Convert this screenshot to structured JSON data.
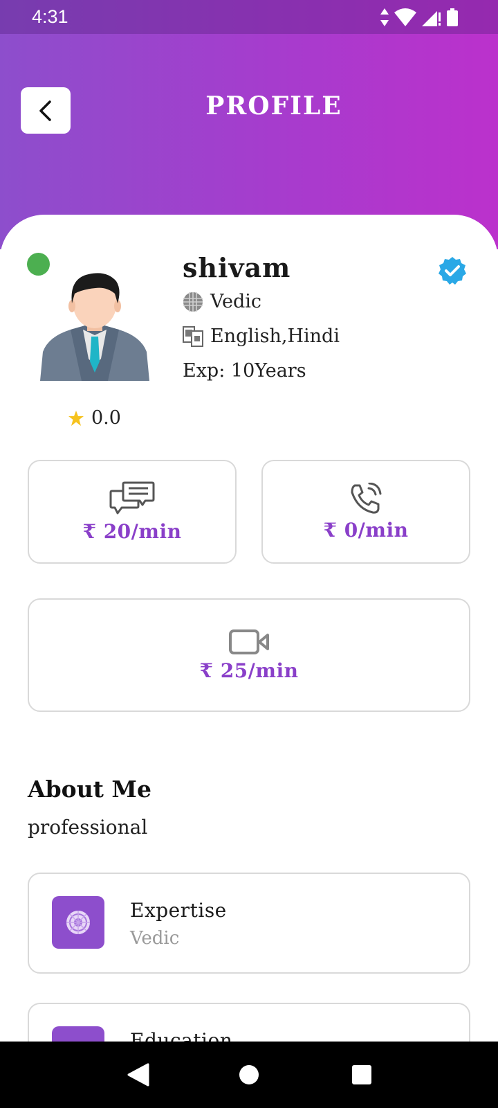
{
  "status_bar": {
    "time": "4:31",
    "icons": [
      "data-arrows-icon",
      "wifi-icon",
      "signal-icon",
      "battery-icon"
    ]
  },
  "header": {
    "title": "PROFILE",
    "back_icon": "chevron-left-icon",
    "gradient_colors": [
      "#8d4ecc",
      "#bb31cc"
    ]
  },
  "profile": {
    "name": "shivam",
    "online": true,
    "online_color": "#4caf50",
    "verified": true,
    "verified_color": "#2aa8e6",
    "skill": "Vedic",
    "languages": "English,Hindi",
    "experience": "Exp: 10Years",
    "rating": "0.0"
  },
  "pricing": {
    "chat": {
      "icon": "chat-bubbles-icon",
      "price": "₹ 20/min"
    },
    "call": {
      "icon": "phone-icon",
      "price": "₹ 0/min"
    },
    "video": {
      "icon": "video-camera-icon",
      "price": "₹ 25/min"
    },
    "accent": "#8a3fc9"
  },
  "about": {
    "title": "About Me",
    "text": "professional"
  },
  "details": [
    {
      "title": "Expertise",
      "value": "Vedic",
      "icon": "mandala-icon"
    },
    {
      "title": "Education",
      "value": "",
      "icon": "education-icon"
    }
  ],
  "nav": {
    "back_icon": "back-triangle-icon",
    "home_icon": "home-circle-icon",
    "recents_icon": "recents-square-icon"
  }
}
